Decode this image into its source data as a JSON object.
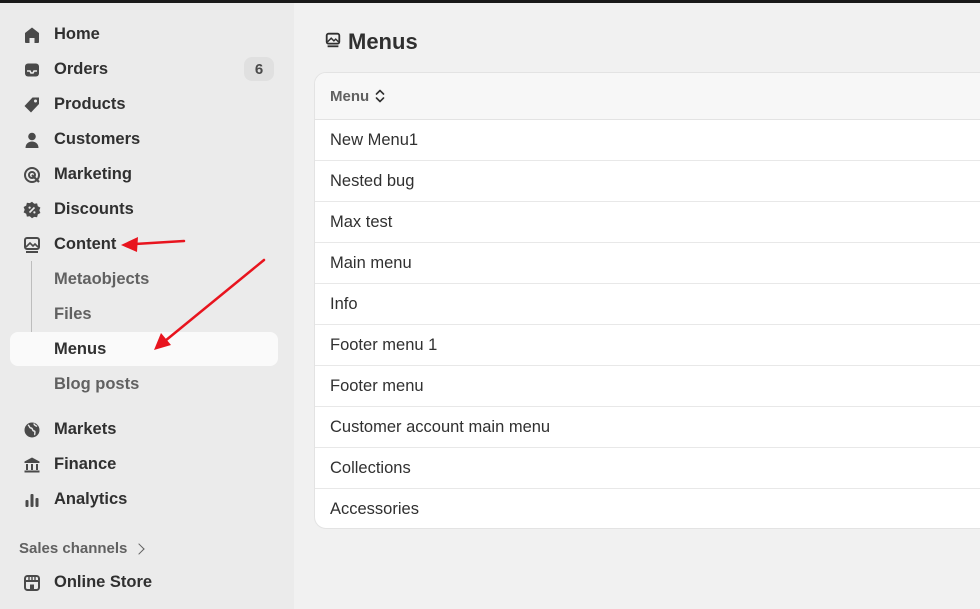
{
  "sidebar": {
    "items": [
      {
        "label": "Home",
        "icon": "home-icon"
      },
      {
        "label": "Orders",
        "icon": "inbox-icon",
        "badge": "6"
      },
      {
        "label": "Products",
        "icon": "tag-icon"
      },
      {
        "label": "Customers",
        "icon": "person-icon"
      },
      {
        "label": "Marketing",
        "icon": "target-icon"
      },
      {
        "label": "Discounts",
        "icon": "discount-icon"
      },
      {
        "label": "Content",
        "icon": "image-icon"
      },
      {
        "label": "Markets",
        "icon": "globe-icon"
      },
      {
        "label": "Finance",
        "icon": "bank-icon"
      },
      {
        "label": "Analytics",
        "icon": "bar-chart-icon"
      }
    ],
    "content_subitems": [
      {
        "label": "Metaobjects"
      },
      {
        "label": "Files"
      },
      {
        "label": "Menus",
        "active": true
      },
      {
        "label": "Blog posts"
      }
    ],
    "sales_channels": {
      "title": "Sales channels",
      "items": [
        {
          "label": "Online Store",
          "icon": "store-icon"
        }
      ]
    }
  },
  "page": {
    "title": "Menus",
    "title_icon": "image-icon"
  },
  "table": {
    "column_header": "Menu",
    "rows": [
      "New Menu1",
      "Nested bug",
      "Max test",
      "Main menu",
      "Info",
      "Footer menu 1",
      "Footer menu",
      "Customer account main menu",
      "Collections",
      "Accessories"
    ]
  },
  "colors": {
    "annotation_arrow": "#e8141e",
    "sidebar_bg": "#ebebeb",
    "main_bg": "#f1f1f1",
    "text": "#303030",
    "muted_text": "#616161"
  }
}
